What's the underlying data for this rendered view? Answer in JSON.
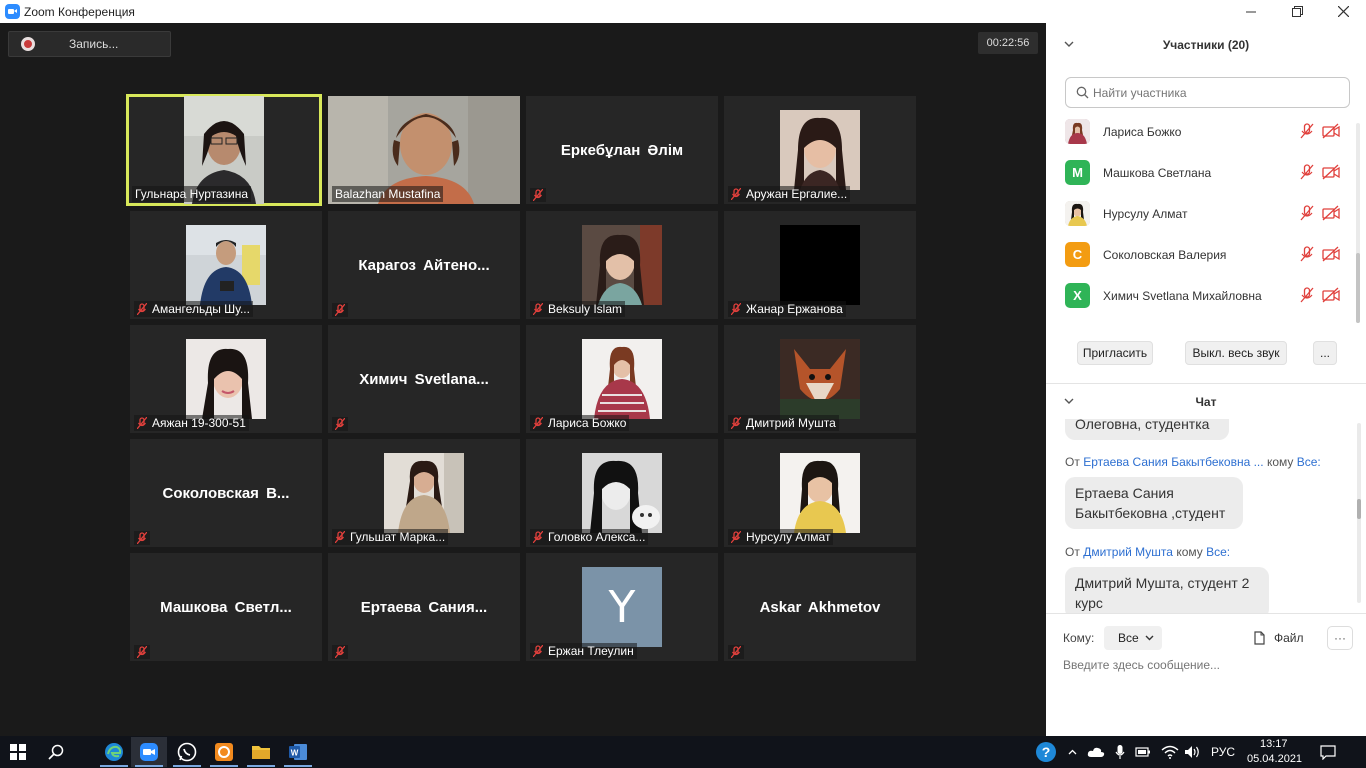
{
  "window": {
    "title": "Zoom Конференция"
  },
  "meeting": {
    "record_label": "Запись...",
    "timer": "00:22:56",
    "tiles": [
      {
        "label": "Гульнара Нуртазина",
        "muted": false,
        "active": true
      },
      {
        "label": "Balazhan Mustafina",
        "muted": false
      },
      {
        "bigname": "Еркебұлан Әлім",
        "muted": true
      },
      {
        "label": "Аружан Ергалие...",
        "muted": true
      },
      {
        "label": "Амангельды Шу...",
        "muted": true
      },
      {
        "bigname": "Карагоз  Айтено...",
        "muted": true
      },
      {
        "label": "Beksulу Islam",
        "muted": true
      },
      {
        "label": "Жанар Ержанова",
        "muted": true
      },
      {
        "label": "Аяжан 19-300-51",
        "muted": true
      },
      {
        "bigname": "Химич  Svetlana...",
        "muted": true
      },
      {
        "label": "Лариса Божко",
        "muted": true
      },
      {
        "label": "Дмитрий Мушта",
        "muted": true
      },
      {
        "bigname": "Соколовская  В...",
        "muted": true
      },
      {
        "label": "Гульшат Марка...",
        "muted": true
      },
      {
        "label": "Головко Алекса...",
        "muted": true
      },
      {
        "label": "Нурсулу Алмат",
        "muted": true
      },
      {
        "bigname": "Машкова  Светл...",
        "muted": true
      },
      {
        "bigname": "Ертаева  Сания...",
        "muted": true
      },
      {
        "label": "Ержан Тлеулин",
        "muted": true,
        "avatar_letter": "Y"
      },
      {
        "bigname": "Askar Akhmetov",
        "muted": true
      }
    ]
  },
  "participants_panel": {
    "title": "Участники (20)",
    "search_placeholder": "Найти участника",
    "items": [
      {
        "name": "Лариса Божко",
        "avatar_letter": "",
        "avatar_color": "#c7a6b0"
      },
      {
        "name": "Машкова Светлана",
        "avatar_letter": "М",
        "avatar_color": "#2fb457"
      },
      {
        "name": "Нурсулу Алмат",
        "avatar_letter": "",
        "avatar_color": "#d8c4b6"
      },
      {
        "name": "Соколовская Валерия",
        "avatar_letter": "С",
        "avatar_color": "#f39c12"
      },
      {
        "name": "Химич Svetlana Михайловна",
        "avatar_letter": "Х",
        "avatar_color": "#2fb457"
      }
    ],
    "invite_label": "Пригласить",
    "mute_all_label": "Выкл. весь звук",
    "more_label": "..."
  },
  "chat_panel": {
    "title": "Чат",
    "messages": [
      {
        "text": "Олеговна, студентка"
      },
      {
        "from_prefix": "От",
        "from": "Ертаева Сания Бакытбековна ...",
        "to_prefix": "кому",
        "to": "Все:",
        "text_line1": "Ертаева Сания",
        "text_line2": "Бакытбековна ,студент"
      },
      {
        "from_prefix": "От",
        "from": "Дмитрий Мушта",
        "to_prefix": "кому",
        "to": "Все:",
        "text_line1": "Дмитрий Мушта, студент 2",
        "text_line2": "курс"
      }
    ],
    "to_label": "Кому:",
    "to_value": "Все",
    "file_label": "Файл",
    "more_label": "···",
    "input_placeholder": "Введите здесь сообщение..."
  },
  "taskbar": {
    "lang": "РУС",
    "time": "13:17",
    "date": "05.04.2021"
  },
  "colors": {
    "accent": "#2d8cff",
    "active_speaker": "#d8e85a",
    "muted_red": "#e0403c",
    "link": "#2d6fd1"
  }
}
